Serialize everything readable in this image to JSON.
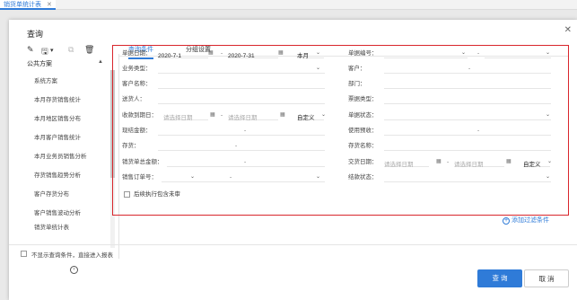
{
  "doc_tab": {
    "label": "销货单统计表",
    "close": "✕"
  },
  "dialog": {
    "title": "查询",
    "close": "✕"
  },
  "toolbar": {
    "edit_icon": "✎",
    "save_icon": "🖫",
    "save_caret": "▾",
    "export_icon": "⧉",
    "delete_icon": "🗑"
  },
  "sidebar": {
    "header": "公共方案",
    "header_caret": "▲",
    "items": [
      "系统方案",
      "本月存货销售统计",
      "本月地区销售分布",
      "本月客户销售统计",
      "本月业务员销售分析",
      "存货销售趋势分析",
      "客户存货分布",
      "客户销售波动分析",
      "销货单统计表"
    ],
    "collapse_icon": "‹"
  },
  "tabs": [
    "查询条件",
    "分组设置"
  ],
  "form": {
    "danju_riqi": {
      "label": "单据日期：",
      "from": "2020-7-1",
      "to": "2020-7-31",
      "period": "本月"
    },
    "danju_bianhao": {
      "label": "单据编号：",
      "sep": "-"
    },
    "yewu_leixing": {
      "label": "业务类型："
    },
    "kehu": {
      "label": "客户：",
      "sep": "-"
    },
    "kehu_mingcheng": {
      "label": "客户名称："
    },
    "bumen": {
      "label": "部门："
    },
    "songhuoren": {
      "label": "送货人："
    },
    "piaoju_leixing": {
      "label": "票据类型："
    },
    "shoukuan_daoqiri": {
      "label": "收款到期日：",
      "ph_from": "请选择日期",
      "ph_to": "请选择日期",
      "mode": "自定义"
    },
    "danju_zhuangtai": {
      "label": "单据状态："
    },
    "xianjie_jine": {
      "label": "现结金额：",
      "sep": "-"
    },
    "shiyong_yushou": {
      "label": "使用预收：",
      "sep": "-"
    },
    "cunhuo": {
      "label": "存货：",
      "sep": "-"
    },
    "cunhuo_mingcheng": {
      "label": "存货名称："
    },
    "xiaohuodan_zongjine": {
      "label": "销货单总金额：",
      "sep": "-"
    },
    "jiaohuo_riqi": {
      "label": "交货日期：",
      "ph_from": "请选择日期",
      "ph_to": "请选择日期",
      "mode": "自定义"
    },
    "xiaoshou_dingdanhao": {
      "label": "销售订单号：",
      "sep": "-"
    },
    "jiekuan_zhuangtai": {
      "label": "结款状态："
    },
    "houxu_zhixing": {
      "label": "后续执行包含未审"
    }
  },
  "add_filter": {
    "icon": "+",
    "label": "添加过滤条件"
  },
  "footer": {
    "skip_label": "不显示查询条件，直接进入报表",
    "query_label": "查 询",
    "cancel_label": "取 消"
  },
  "glyphs": {
    "caret": "⌄",
    "calendar": "▦",
    "dash": "-"
  }
}
